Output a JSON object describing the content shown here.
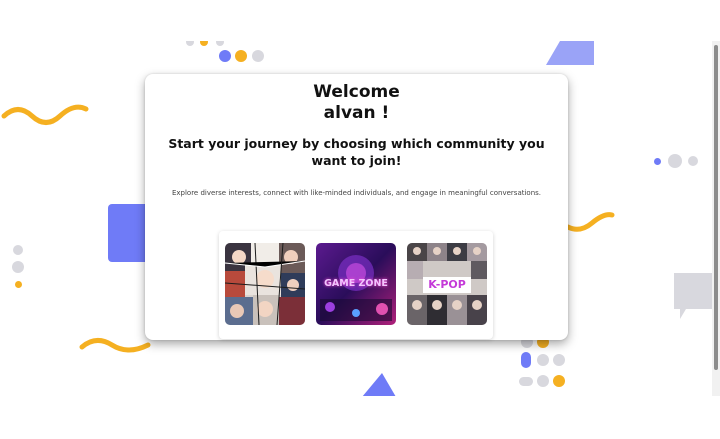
{
  "welcome": {
    "line1": "Welcome",
    "line2": "alvan !",
    "subtitle": "Start your journey by choosing which community you want to join!",
    "description": "Explore diverse interests, connect with like-minded individuals, and engage in meaningful conversations."
  },
  "communities": [
    {
      "id": "anime",
      "label": ""
    },
    {
      "id": "game",
      "label": "GAME ZONE"
    },
    {
      "id": "kpop",
      "label": "K-POP"
    }
  ],
  "colors": {
    "primary": "#6f7bf7",
    "accent": "#f5b021",
    "gray": "#d8d8de",
    "light_blue": "#9aa3f7"
  }
}
